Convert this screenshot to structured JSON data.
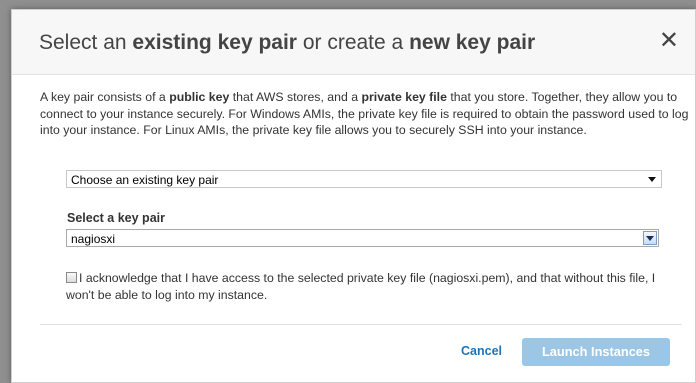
{
  "dialog": {
    "title_prefix": "Select an",
    "title_bold1": "existing key pair",
    "title_mid": "or create a",
    "title_bold2": "new key pair",
    "close_glyph": "✕"
  },
  "description": {
    "part1": "A key pair consists of a",
    "bold1": "public key",
    "part2": "that AWS stores, and a",
    "bold2": "private key file",
    "part3": "that you store. Together, they allow you to connect to your instance securely. For Windows AMIs, the private key file is required to obtain the password used to log into your instance. For Linux AMIs, the private key file allows you to securely SSH into your instance."
  },
  "mode_select": {
    "selected": "Choose an existing key pair"
  },
  "keypair": {
    "label": "Select a key pair",
    "selected": "nagiosxi"
  },
  "acknowledge": {
    "text": "I acknowledge that I have access to the selected private key file (nagiosxi.pem), and that without this file, I won't be able to log into my instance.",
    "checked": false
  },
  "footer": {
    "cancel_label": "Cancel",
    "launch_label": "Launch Instances"
  },
  "colors": {
    "link": "#1e73b8",
    "launch_disabled": "#9cc6e6"
  }
}
